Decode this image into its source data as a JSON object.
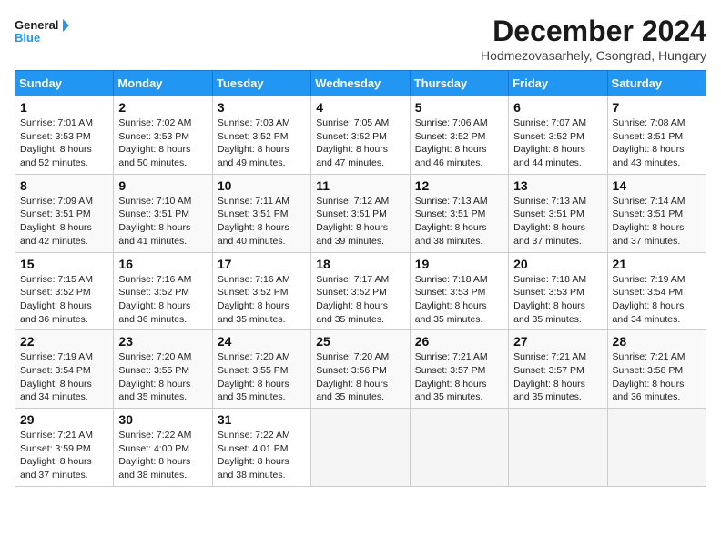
{
  "header": {
    "logo_line1": "General",
    "logo_line2": "Blue",
    "month_title": "December 2024",
    "subtitle": "Hodmezovasarhely, Csongrad, Hungary"
  },
  "weekdays": [
    "Sunday",
    "Monday",
    "Tuesday",
    "Wednesday",
    "Thursday",
    "Friday",
    "Saturday"
  ],
  "weeks": [
    [
      {
        "day": "1",
        "sunrise": "Sunrise: 7:01 AM",
        "sunset": "Sunset: 3:53 PM",
        "daylight": "Daylight: 8 hours and 52 minutes."
      },
      {
        "day": "2",
        "sunrise": "Sunrise: 7:02 AM",
        "sunset": "Sunset: 3:53 PM",
        "daylight": "Daylight: 8 hours and 50 minutes."
      },
      {
        "day": "3",
        "sunrise": "Sunrise: 7:03 AM",
        "sunset": "Sunset: 3:52 PM",
        "daylight": "Daylight: 8 hours and 49 minutes."
      },
      {
        "day": "4",
        "sunrise": "Sunrise: 7:05 AM",
        "sunset": "Sunset: 3:52 PM",
        "daylight": "Daylight: 8 hours and 47 minutes."
      },
      {
        "day": "5",
        "sunrise": "Sunrise: 7:06 AM",
        "sunset": "Sunset: 3:52 PM",
        "daylight": "Daylight: 8 hours and 46 minutes."
      },
      {
        "day": "6",
        "sunrise": "Sunrise: 7:07 AM",
        "sunset": "Sunset: 3:52 PM",
        "daylight": "Daylight: 8 hours and 44 minutes."
      },
      {
        "day": "7",
        "sunrise": "Sunrise: 7:08 AM",
        "sunset": "Sunset: 3:51 PM",
        "daylight": "Daylight: 8 hours and 43 minutes."
      }
    ],
    [
      {
        "day": "8",
        "sunrise": "Sunrise: 7:09 AM",
        "sunset": "Sunset: 3:51 PM",
        "daylight": "Daylight: 8 hours and 42 minutes."
      },
      {
        "day": "9",
        "sunrise": "Sunrise: 7:10 AM",
        "sunset": "Sunset: 3:51 PM",
        "daylight": "Daylight: 8 hours and 41 minutes."
      },
      {
        "day": "10",
        "sunrise": "Sunrise: 7:11 AM",
        "sunset": "Sunset: 3:51 PM",
        "daylight": "Daylight: 8 hours and 40 minutes."
      },
      {
        "day": "11",
        "sunrise": "Sunrise: 7:12 AM",
        "sunset": "Sunset: 3:51 PM",
        "daylight": "Daylight: 8 hours and 39 minutes."
      },
      {
        "day": "12",
        "sunrise": "Sunrise: 7:13 AM",
        "sunset": "Sunset: 3:51 PM",
        "daylight": "Daylight: 8 hours and 38 minutes."
      },
      {
        "day": "13",
        "sunrise": "Sunrise: 7:13 AM",
        "sunset": "Sunset: 3:51 PM",
        "daylight": "Daylight: 8 hours and 37 minutes."
      },
      {
        "day": "14",
        "sunrise": "Sunrise: 7:14 AM",
        "sunset": "Sunset: 3:51 PM",
        "daylight": "Daylight: 8 hours and 37 minutes."
      }
    ],
    [
      {
        "day": "15",
        "sunrise": "Sunrise: 7:15 AM",
        "sunset": "Sunset: 3:52 PM",
        "daylight": "Daylight: 8 hours and 36 minutes."
      },
      {
        "day": "16",
        "sunrise": "Sunrise: 7:16 AM",
        "sunset": "Sunset: 3:52 PM",
        "daylight": "Daylight: 8 hours and 36 minutes."
      },
      {
        "day": "17",
        "sunrise": "Sunrise: 7:16 AM",
        "sunset": "Sunset: 3:52 PM",
        "daylight": "Daylight: 8 hours and 35 minutes."
      },
      {
        "day": "18",
        "sunrise": "Sunrise: 7:17 AM",
        "sunset": "Sunset: 3:52 PM",
        "daylight": "Daylight: 8 hours and 35 minutes."
      },
      {
        "day": "19",
        "sunrise": "Sunrise: 7:18 AM",
        "sunset": "Sunset: 3:53 PM",
        "daylight": "Daylight: 8 hours and 35 minutes."
      },
      {
        "day": "20",
        "sunrise": "Sunrise: 7:18 AM",
        "sunset": "Sunset: 3:53 PM",
        "daylight": "Daylight: 8 hours and 35 minutes."
      },
      {
        "day": "21",
        "sunrise": "Sunrise: 7:19 AM",
        "sunset": "Sunset: 3:54 PM",
        "daylight": "Daylight: 8 hours and 34 minutes."
      }
    ],
    [
      {
        "day": "22",
        "sunrise": "Sunrise: 7:19 AM",
        "sunset": "Sunset: 3:54 PM",
        "daylight": "Daylight: 8 hours and 34 minutes."
      },
      {
        "day": "23",
        "sunrise": "Sunrise: 7:20 AM",
        "sunset": "Sunset: 3:55 PM",
        "daylight": "Daylight: 8 hours and 35 minutes."
      },
      {
        "day": "24",
        "sunrise": "Sunrise: 7:20 AM",
        "sunset": "Sunset: 3:55 PM",
        "daylight": "Daylight: 8 hours and 35 minutes."
      },
      {
        "day": "25",
        "sunrise": "Sunrise: 7:20 AM",
        "sunset": "Sunset: 3:56 PM",
        "daylight": "Daylight: 8 hours and 35 minutes."
      },
      {
        "day": "26",
        "sunrise": "Sunrise: 7:21 AM",
        "sunset": "Sunset: 3:57 PM",
        "daylight": "Daylight: 8 hours and 35 minutes."
      },
      {
        "day": "27",
        "sunrise": "Sunrise: 7:21 AM",
        "sunset": "Sunset: 3:57 PM",
        "daylight": "Daylight: 8 hours and 35 minutes."
      },
      {
        "day": "28",
        "sunrise": "Sunrise: 7:21 AM",
        "sunset": "Sunset: 3:58 PM",
        "daylight": "Daylight: 8 hours and 36 minutes."
      }
    ],
    [
      {
        "day": "29",
        "sunrise": "Sunrise: 7:21 AM",
        "sunset": "Sunset: 3:59 PM",
        "daylight": "Daylight: 8 hours and 37 minutes."
      },
      {
        "day": "30",
        "sunrise": "Sunrise: 7:22 AM",
        "sunset": "Sunset: 4:00 PM",
        "daylight": "Daylight: 8 hours and 38 minutes."
      },
      {
        "day": "31",
        "sunrise": "Sunrise: 7:22 AM",
        "sunset": "Sunset: 4:01 PM",
        "daylight": "Daylight: 8 hours and 38 minutes."
      },
      null,
      null,
      null,
      null
    ]
  ]
}
